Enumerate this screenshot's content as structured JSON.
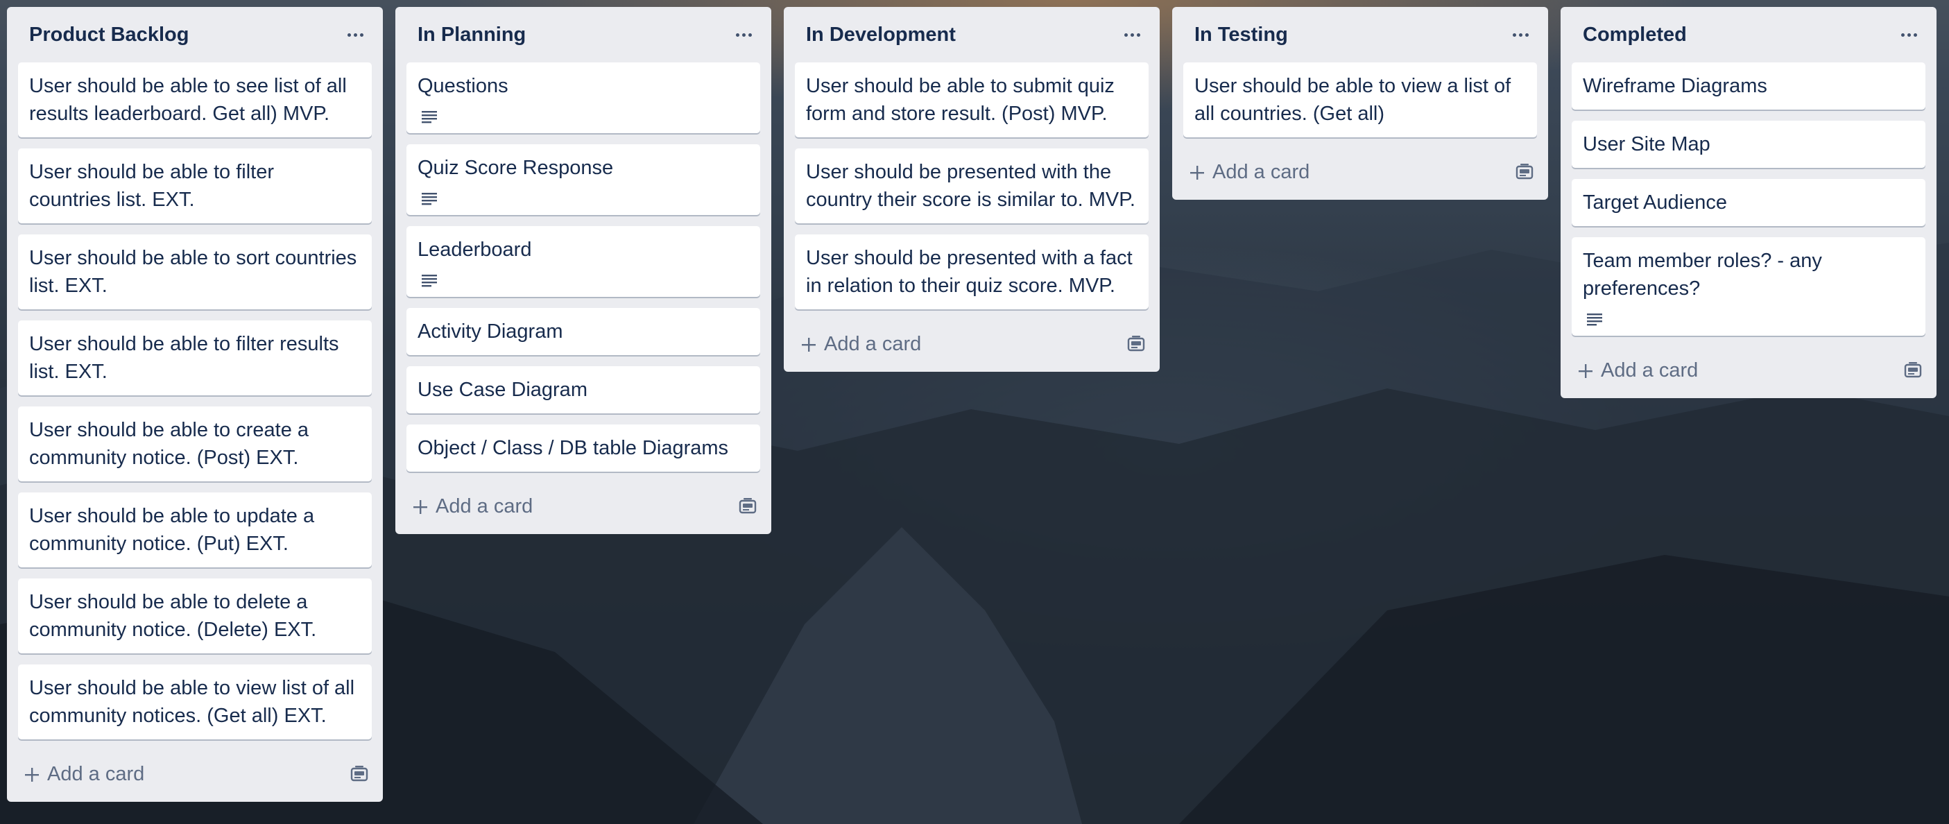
{
  "board": {
    "lists": [
      {
        "title": "Product Backlog",
        "cards": [
          {
            "text": "User should be able to see list of all results leaderboard. Get all) MVP.",
            "has_description": false
          },
          {
            "text": "User should be able to filter countries list. EXT.",
            "has_description": false
          },
          {
            "text": "User should be able to sort countries list. EXT.",
            "has_description": false
          },
          {
            "text": "User should be able to filter results list. EXT.",
            "has_description": false
          },
          {
            "text": "User should be able to create a community notice. (Post) EXT.",
            "has_description": false
          },
          {
            "text": "User should be able to update a community notice. (Put) EXT.",
            "has_description": false
          },
          {
            "text": "User should be able to delete a community notice. (Delete) EXT.",
            "has_description": false
          },
          {
            "text": "User should be able to view list of all community notices. (Get all) EXT.",
            "has_description": false
          }
        ],
        "add_label": "Add a card"
      },
      {
        "title": "In Planning",
        "cards": [
          {
            "text": "Questions",
            "has_description": true
          },
          {
            "text": "Quiz Score Response",
            "has_description": true
          },
          {
            "text": "Leaderboard",
            "has_description": true
          },
          {
            "text": "Activity Diagram",
            "has_description": false
          },
          {
            "text": "Use Case Diagram",
            "has_description": false
          },
          {
            "text": "Object / Class / DB table Diagrams",
            "has_description": false
          }
        ],
        "add_label": "Add a card"
      },
      {
        "title": "In Development",
        "cards": [
          {
            "text": "User should be able to submit quiz form and store result. (Post) MVP.",
            "has_description": false
          },
          {
            "text": "User should be presented with the country their score is similar to. MVP.",
            "has_description": false
          },
          {
            "text": "User should be presented with a fact in relation to their quiz score. MVP.",
            "has_description": false
          }
        ],
        "add_label": "Add a card"
      },
      {
        "title": "In Testing",
        "cards": [
          {
            "text": "User should be able to view a list of all countries. (Get all)",
            "has_description": false
          }
        ],
        "add_label": "Add a card"
      },
      {
        "title": "Completed",
        "cards": [
          {
            "text": "Wireframe Diagrams",
            "has_description": false
          },
          {
            "text": "User Site Map",
            "has_description": false
          },
          {
            "text": "Target Audience",
            "has_description": false
          },
          {
            "text": "Team member roles? - any preferences?",
            "has_description": true
          }
        ],
        "add_label": "Add a card"
      }
    ]
  },
  "icons": {
    "list_menu": "more-horizontal-icon",
    "card_description": "description-lines-icon",
    "add": "plus-icon",
    "template": "card-template-icon"
  },
  "colors": {
    "list_bg": "#ebecf0",
    "card_bg": "#ffffff",
    "title_text": "#172b4d",
    "muted_text": "#5e6c84"
  }
}
